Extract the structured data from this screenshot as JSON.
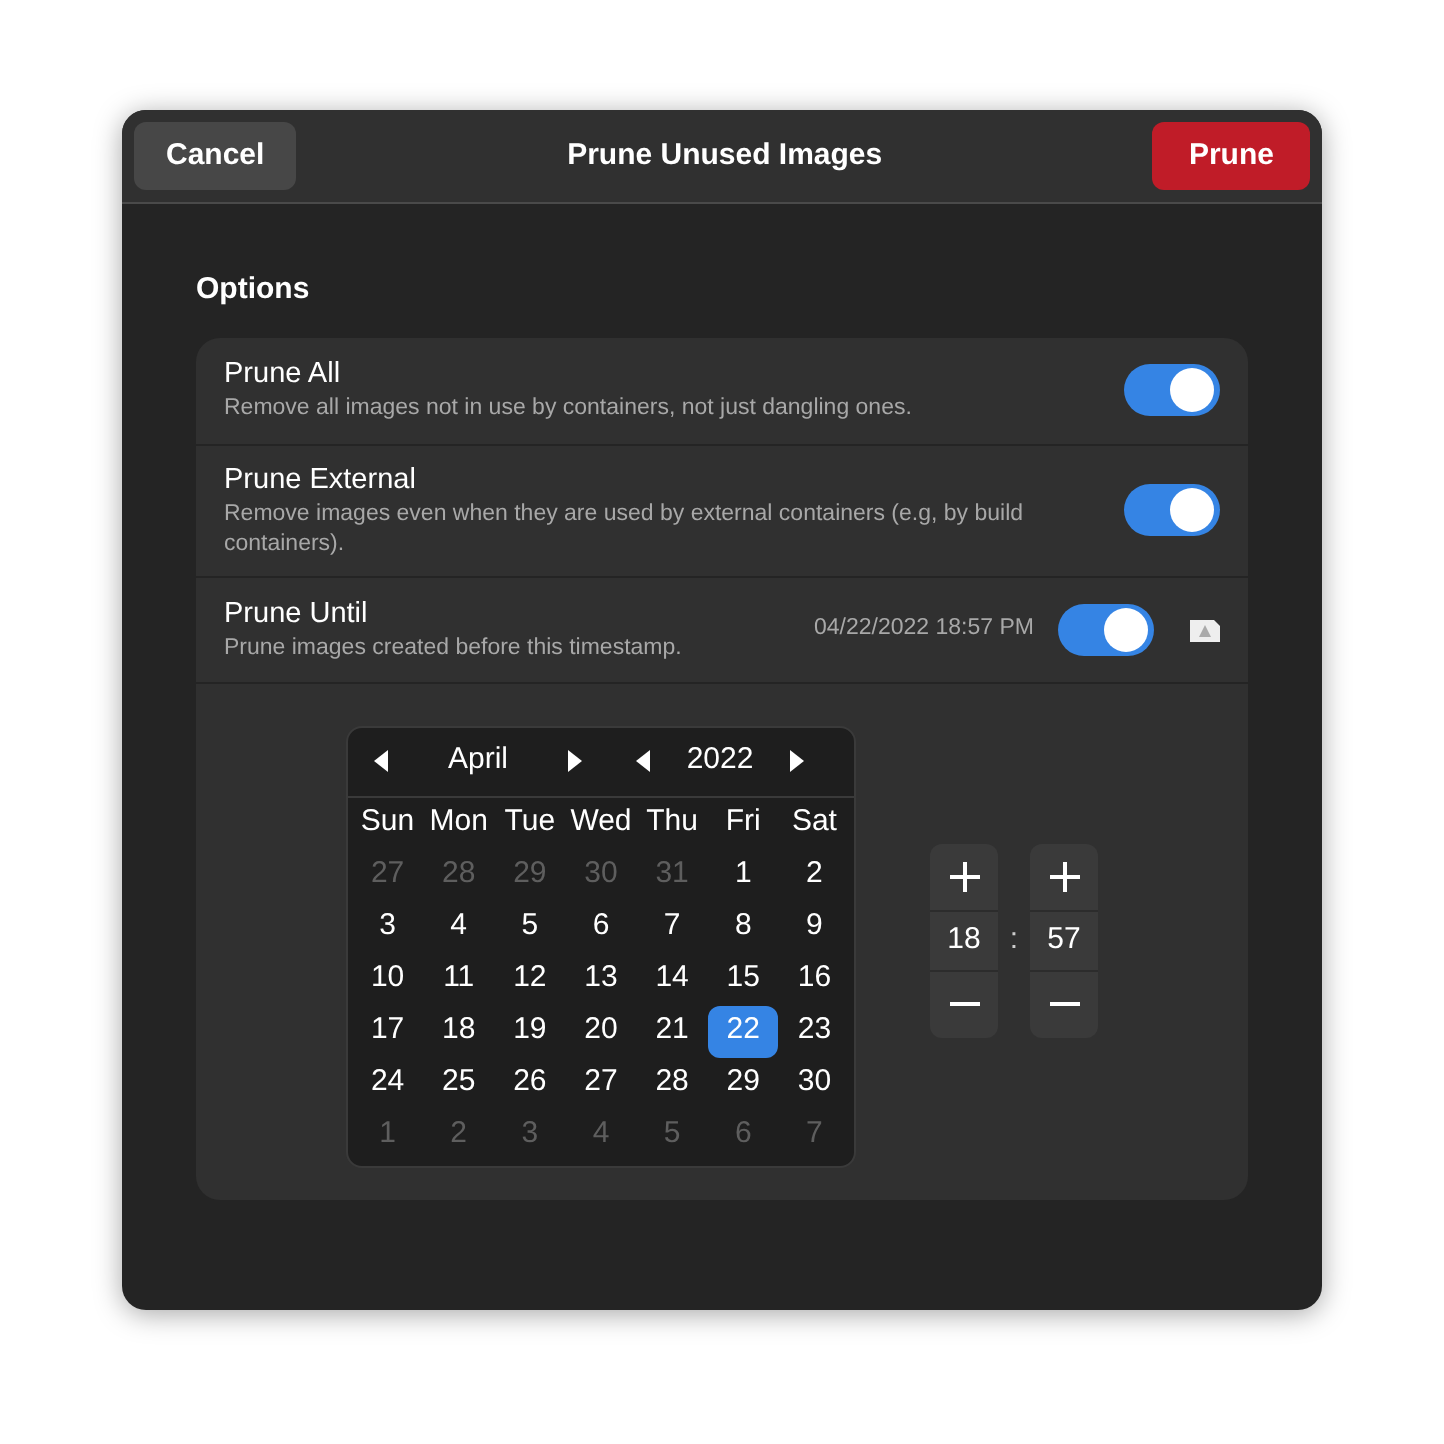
{
  "header": {
    "cancel": "Cancel",
    "title": "Prune Unused Images",
    "confirm": "Prune"
  },
  "section_title": "Options",
  "options": [
    {
      "kind": "toggle",
      "title": "Prune All",
      "subtitle": "Remove all images not in use by containers, not just dangling ones.",
      "on": true
    },
    {
      "kind": "toggle",
      "title": "Prune External",
      "subtitle": "Remove images even when they are used by external containers (e.g, by build containers).",
      "on": true
    },
    {
      "kind": "timestamp",
      "title": "Prune Until",
      "subtitle": "Prune images created before this timestamp.",
      "value": "04/22/2022 18:57 PM",
      "on": true
    }
  ],
  "calendar": {
    "month": "April",
    "year": "2022",
    "weekdays": [
      "Sun",
      "Mon",
      "Tue",
      "Wed",
      "Thu",
      "Fri",
      "Sat"
    ],
    "days": [
      {
        "label": "27",
        "dim": true,
        "selected": false
      },
      {
        "label": "28",
        "dim": true,
        "selected": false
      },
      {
        "label": "29",
        "dim": true,
        "selected": false
      },
      {
        "label": "30",
        "dim": true,
        "selected": false
      },
      {
        "label": "31",
        "dim": true,
        "selected": false
      },
      {
        "label": "1",
        "dim": false,
        "selected": false
      },
      {
        "label": "2",
        "dim": false,
        "selected": false
      },
      {
        "label": "3",
        "dim": false,
        "selected": false
      },
      {
        "label": "4",
        "dim": false,
        "selected": false
      },
      {
        "label": "5",
        "dim": false,
        "selected": false
      },
      {
        "label": "6",
        "dim": false,
        "selected": false
      },
      {
        "label": "7",
        "dim": false,
        "selected": false
      },
      {
        "label": "8",
        "dim": false,
        "selected": false
      },
      {
        "label": "9",
        "dim": false,
        "selected": false
      },
      {
        "label": "10",
        "dim": false,
        "selected": false
      },
      {
        "label": "11",
        "dim": false,
        "selected": false
      },
      {
        "label": "12",
        "dim": false,
        "selected": false
      },
      {
        "label": "13",
        "dim": false,
        "selected": false
      },
      {
        "label": "14",
        "dim": false,
        "selected": false
      },
      {
        "label": "15",
        "dim": false,
        "selected": false
      },
      {
        "label": "16",
        "dim": false,
        "selected": false
      },
      {
        "label": "17",
        "dim": false,
        "selected": false
      },
      {
        "label": "18",
        "dim": false,
        "selected": false
      },
      {
        "label": "19",
        "dim": false,
        "selected": false
      },
      {
        "label": "20",
        "dim": false,
        "selected": false
      },
      {
        "label": "21",
        "dim": false,
        "selected": false
      },
      {
        "label": "22",
        "dim": false,
        "selected": true
      },
      {
        "label": "23",
        "dim": false,
        "selected": false
      },
      {
        "label": "24",
        "dim": false,
        "selected": false
      },
      {
        "label": "25",
        "dim": false,
        "selected": false
      },
      {
        "label": "26",
        "dim": false,
        "selected": false
      },
      {
        "label": "27",
        "dim": false,
        "selected": false
      },
      {
        "label": "28",
        "dim": false,
        "selected": false
      },
      {
        "label": "29",
        "dim": false,
        "selected": false
      },
      {
        "label": "30",
        "dim": false,
        "selected": false
      },
      {
        "label": "1",
        "dim": true,
        "selected": false
      },
      {
        "label": "2",
        "dim": true,
        "selected": false
      },
      {
        "label": "3",
        "dim": true,
        "selected": false
      },
      {
        "label": "4",
        "dim": true,
        "selected": false
      },
      {
        "label": "5",
        "dim": true,
        "selected": false
      },
      {
        "label": "6",
        "dim": true,
        "selected": false
      },
      {
        "label": "7",
        "dim": true,
        "selected": false
      }
    ]
  },
  "time": {
    "hour": "18",
    "separator": ":",
    "minute": "57"
  }
}
